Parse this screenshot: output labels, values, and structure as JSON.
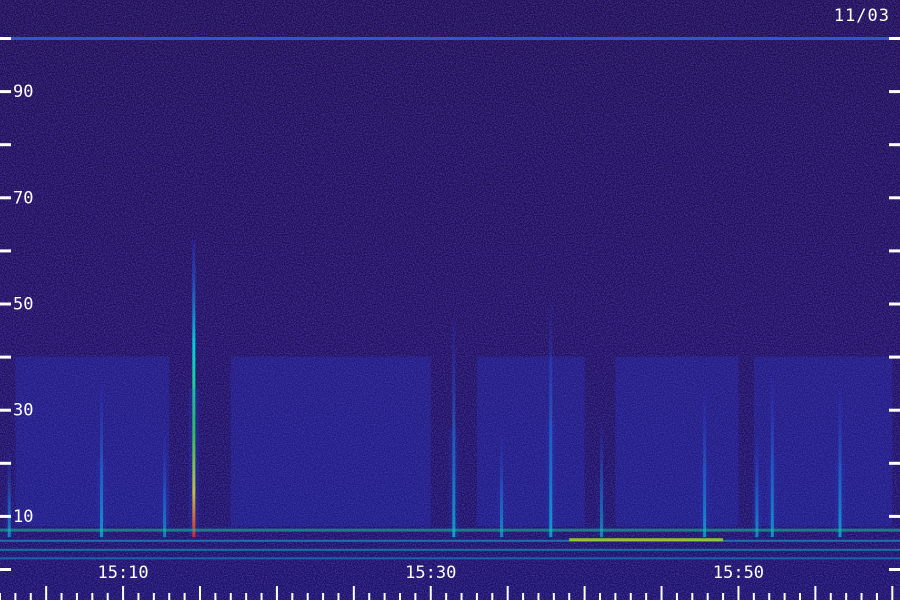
{
  "date": "11/03",
  "chart_data": {
    "type": "heatmap",
    "title": "",
    "xlabel": "",
    "ylabel": "",
    "x_tick_labels": [
      "15:10",
      "15:30",
      "15:50"
    ],
    "x_label_times_min": [
      10,
      30,
      50
    ],
    "x_range_min": [
      2,
      60.5
    ],
    "y_tick_labels": [
      "10",
      "30",
      "50",
      "70",
      "90"
    ],
    "y_tick_values": [
      10,
      30,
      50,
      70,
      90
    ],
    "y_minor_tick_values": [
      0,
      20,
      40,
      60,
      80,
      100
    ],
    "ylim": [
      0,
      100
    ],
    "colormap": [
      "#1a0a48",
      "#2a0fa0",
      "#1f3cf0",
      "#00d8e0",
      "#20e060",
      "#f0f020",
      "#ff2000"
    ],
    "events": [
      {
        "time_min": 2.6,
        "freq_top": 22,
        "intensity": 0.5
      },
      {
        "time_min": 8.6,
        "freq_top": 35,
        "intensity": 0.6
      },
      {
        "time_min": 12.7,
        "freq_top": 25,
        "intensity": 0.4
      },
      {
        "time_min": 14.6,
        "freq_top": 62,
        "intensity": 1.0
      },
      {
        "time_min": 31.5,
        "freq_top": 47,
        "intensity": 0.7
      },
      {
        "time_min": 34.6,
        "freq_top": 25,
        "intensity": 0.45
      },
      {
        "time_min": 37.8,
        "freq_top": 50,
        "intensity": 0.65
      },
      {
        "time_min": 41.1,
        "freq_top": 28,
        "intensity": 0.4
      },
      {
        "time_min": 47.8,
        "freq_top": 33,
        "intensity": 0.55
      },
      {
        "time_min": 51.2,
        "freq_top": 25,
        "intensity": 0.45
      },
      {
        "time_min": 52.2,
        "freq_top": 36,
        "intensity": 0.55
      },
      {
        "time_min": 56.6,
        "freq_top": 34,
        "intensity": 0.6
      }
    ]
  }
}
